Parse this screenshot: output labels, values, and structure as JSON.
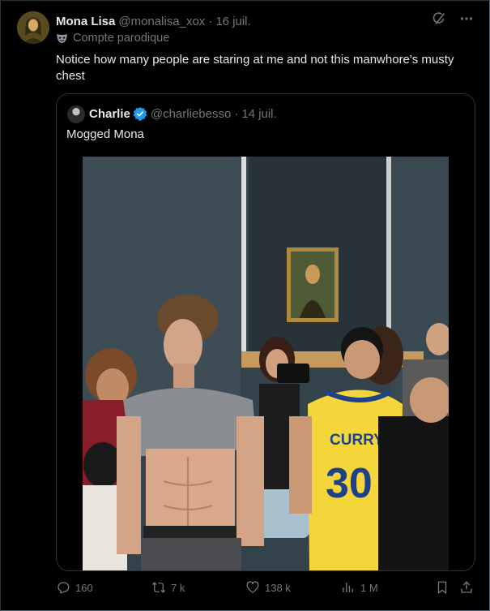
{
  "tweet": {
    "author_name": "Mona Lisa",
    "author_handle": "@monalisa_xox",
    "separator": "·",
    "date": "16 juil.",
    "parody_label": "Compte parodique",
    "text": "Notice how many people are staring at me and not this manwhore's musty chest"
  },
  "quoted_tweet": {
    "author_name": "Charlie",
    "author_handle": "@charliebesso",
    "separator": "·",
    "date": "14 juil.",
    "text": "Mogged Mona",
    "jersey_name": "CURRY",
    "jersey_number": "30"
  },
  "actions": {
    "replies": "160",
    "reposts": "7 k",
    "likes": "138 k",
    "views": "1 M"
  },
  "icons": [
    "grok-icon",
    "more-icon",
    "mask-icon",
    "verified-icon",
    "reply-icon",
    "repost-icon",
    "like-icon",
    "views-icon",
    "bookmark-icon",
    "share-icon"
  ],
  "colors": {
    "background": "#000000",
    "text": "#e7e9ea",
    "muted": "#71767b",
    "border": "#2f3336",
    "verified": "#1d9bf0",
    "jersey": "#f5d63a",
    "jersey_blue": "#1d428a"
  }
}
